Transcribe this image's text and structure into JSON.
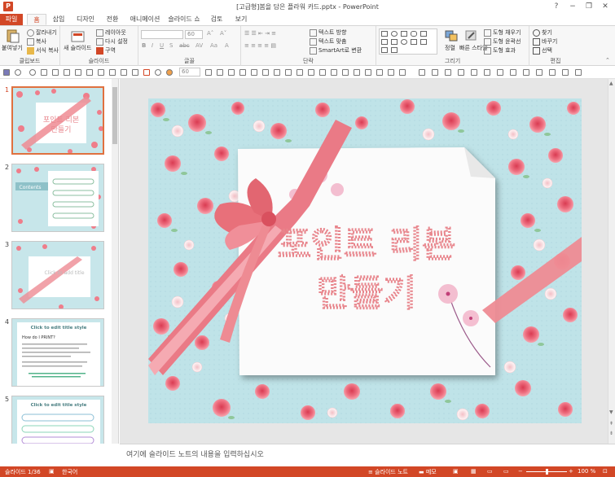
{
  "window": {
    "title": "[고급형]봄을 담은 플라워 카드.pptx - PowerPoint",
    "help": "?",
    "minimize": "−",
    "restore": "❐",
    "close": "✕"
  },
  "tabs": [
    "파일",
    "홈",
    "삽입",
    "디자인",
    "전환",
    "애니메이션",
    "슬라이드 쇼",
    "검토",
    "보기"
  ],
  "ribbon": {
    "clipboard": {
      "paste": "붙여넣기",
      "cut": "잘라내기",
      "copy": "복사",
      "format_painter": "서식 복사",
      "label": "클립보드"
    },
    "slides": {
      "new_slide": "새 슬라이드",
      "layout": "레이아웃",
      "reset": "다시 설정",
      "section": "구역",
      "label": "슬라이드"
    },
    "font": {
      "font_size": "60",
      "label": "글꼴"
    },
    "paragraph": {
      "text_direction": "텍스트 방향",
      "align_text": "텍스트 맞춤",
      "smartart": "SmartArt로 변환",
      "label": "단락"
    },
    "drawing": {
      "arrange": "정렬",
      "quick_styles": "빠른 스타일",
      "shape_fill": "도형 채우기",
      "shape_outline": "도형 윤곽선",
      "shape_effects": "도형 효과",
      "label": "그리기"
    },
    "editing": {
      "find": "찾기",
      "replace": "바꾸기",
      "select": "선택",
      "label": "편집"
    }
  },
  "qat": {
    "font_size": "60"
  },
  "thumbnails": [
    {
      "num": "1",
      "title": "포인트 리본 만들기"
    },
    {
      "num": "2",
      "title": "Contents"
    },
    {
      "num": "3",
      "title": "Click to add title"
    },
    {
      "num": "4",
      "title": "Click to edit title style",
      "body": "How do I PRINT?"
    },
    {
      "num": "5",
      "title": "Click to edit title style"
    }
  ],
  "slide": {
    "title_line1": "포인트 리본",
    "title_line2": "만들기"
  },
  "notes_placeholder": "여기에 슬라이드 노트의 내용을 입력하십시오",
  "status": {
    "slide_counter": "슬라이드 1/36",
    "language": "한국어",
    "notes": "슬라이드 노트",
    "comments": "메모",
    "zoom": "100 %"
  },
  "colors": {
    "accent": "#d24726",
    "slide_bg": "#bfe3e8",
    "ribbon": "#e8707a",
    "title_text": "#e8858c"
  }
}
